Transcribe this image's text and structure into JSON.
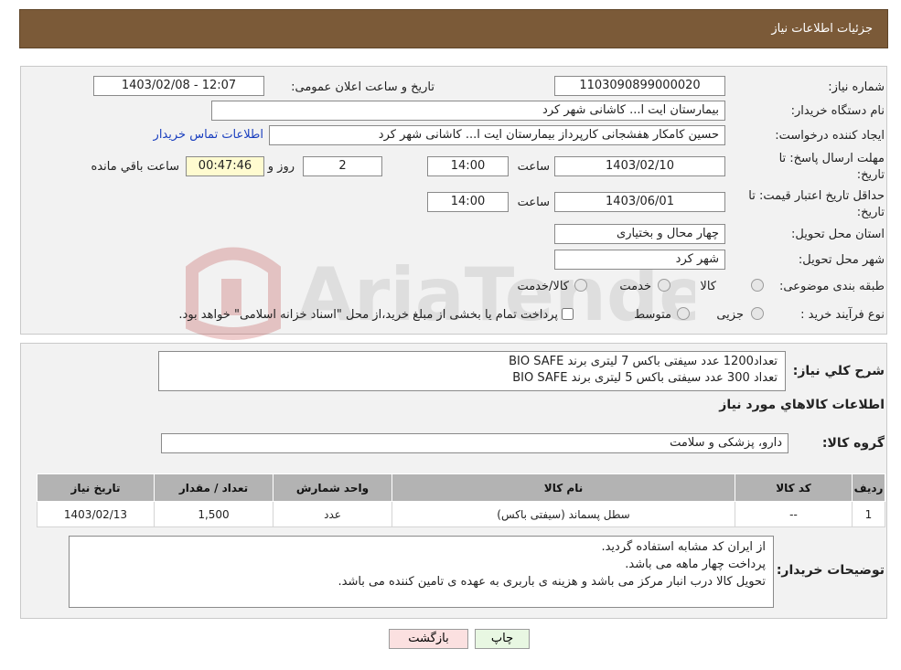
{
  "header": {
    "title": "جزئیات اطلاعات نیاز"
  },
  "fields": {
    "need_number_label": "شماره نیاز:",
    "need_number": "1103090899000020",
    "announce_label": "تاریخ و ساعت اعلان عمومی:",
    "announce_value": "1403/02/08 - 12:07",
    "buyer_org_label": "نام دستگاه خریدار:",
    "buyer_org": "بیمارستان ایت ا... کاشانی شهر کرد",
    "creator_label": "ایجاد کننده درخواست:",
    "creator": "حسین کامکار هفشجانی کارپرداز بیمارستان ایت ا... کاشانی شهر کرد",
    "contact_link": "اطلاعات تماس خریدار",
    "deadline_label_1": "مهلت ارسال پاسخ: تا",
    "deadline_label_2": "تاریخ:",
    "deadline_date": "1403/02/10",
    "time_label": "ساعت",
    "deadline_time": "14:00",
    "days_value": "2",
    "days_label": "روز و",
    "remaining_time": "00:47:46",
    "remaining_label": "ساعت باقي مانده",
    "validity_label_1": "حداقل تاریخ اعتبار قیمت: تا",
    "validity_label_2": "تاریخ:",
    "validity_date": "1403/06/01",
    "validity_time": "14:00",
    "province_label": "استان محل تحویل:",
    "province": "چهار محال و بختیاری",
    "city_label": "شهر محل تحویل:",
    "city": "شهر کرد",
    "category_label": "طبقه بندی موضوعی:",
    "category_options": [
      "کالا",
      "خدمت",
      "کالا/خدمت"
    ],
    "process_label": "نوع فرآیند خرید :",
    "process_options": [
      "جزیی",
      "متوسط"
    ],
    "process_note": "پرداخت تمام یا بخشی از مبلغ خرید،از محل \"اسناد خزانه اسلامی\" خواهد بود."
  },
  "general": {
    "desc_label": "شرح کلي نياز:",
    "desc_lines": [
      "تعداد1200 عدد سیفتی باکس 7 لیتری برند BIO SAFE",
      "تعداد 300 عدد سیفتی باکس 5 لیتری برند BIO SAFE"
    ],
    "goods_info_label": "اطلاعات کالاهاي مورد نياز",
    "goods_group_label": "گروه کالا:",
    "goods_group": "دارو، پزشکی و سلامت"
  },
  "table": {
    "headers": [
      "رديف",
      "کد کالا",
      "نام کالا",
      "واحد شمارش",
      "تعداد / مقدار",
      "تاریخ نیاز"
    ],
    "rows": [
      [
        "1",
        "--",
        "سطل پسماند (سیفتی باکس)",
        "عدد",
        "1,500",
        "1403/02/13"
      ]
    ]
  },
  "notes": {
    "label": "توضیحات خریدار:",
    "lines": [
      "از ایران کد مشابه استفاده گردید.",
      "پرداخت چهار ماهه می باشد.",
      "تحویل کالا درب انبار مرکز می باشد و هزینه ی باربری به عهده ی تامین کننده می باشد."
    ]
  },
  "buttons": {
    "print": "چاپ",
    "back": "بازگشت"
  },
  "colors": {
    "header_bg": "#7b5a38",
    "timer_bg": "#fffbd0",
    "print_bg": "#e8f7e2",
    "back_bg": "#fbe0e0"
  }
}
